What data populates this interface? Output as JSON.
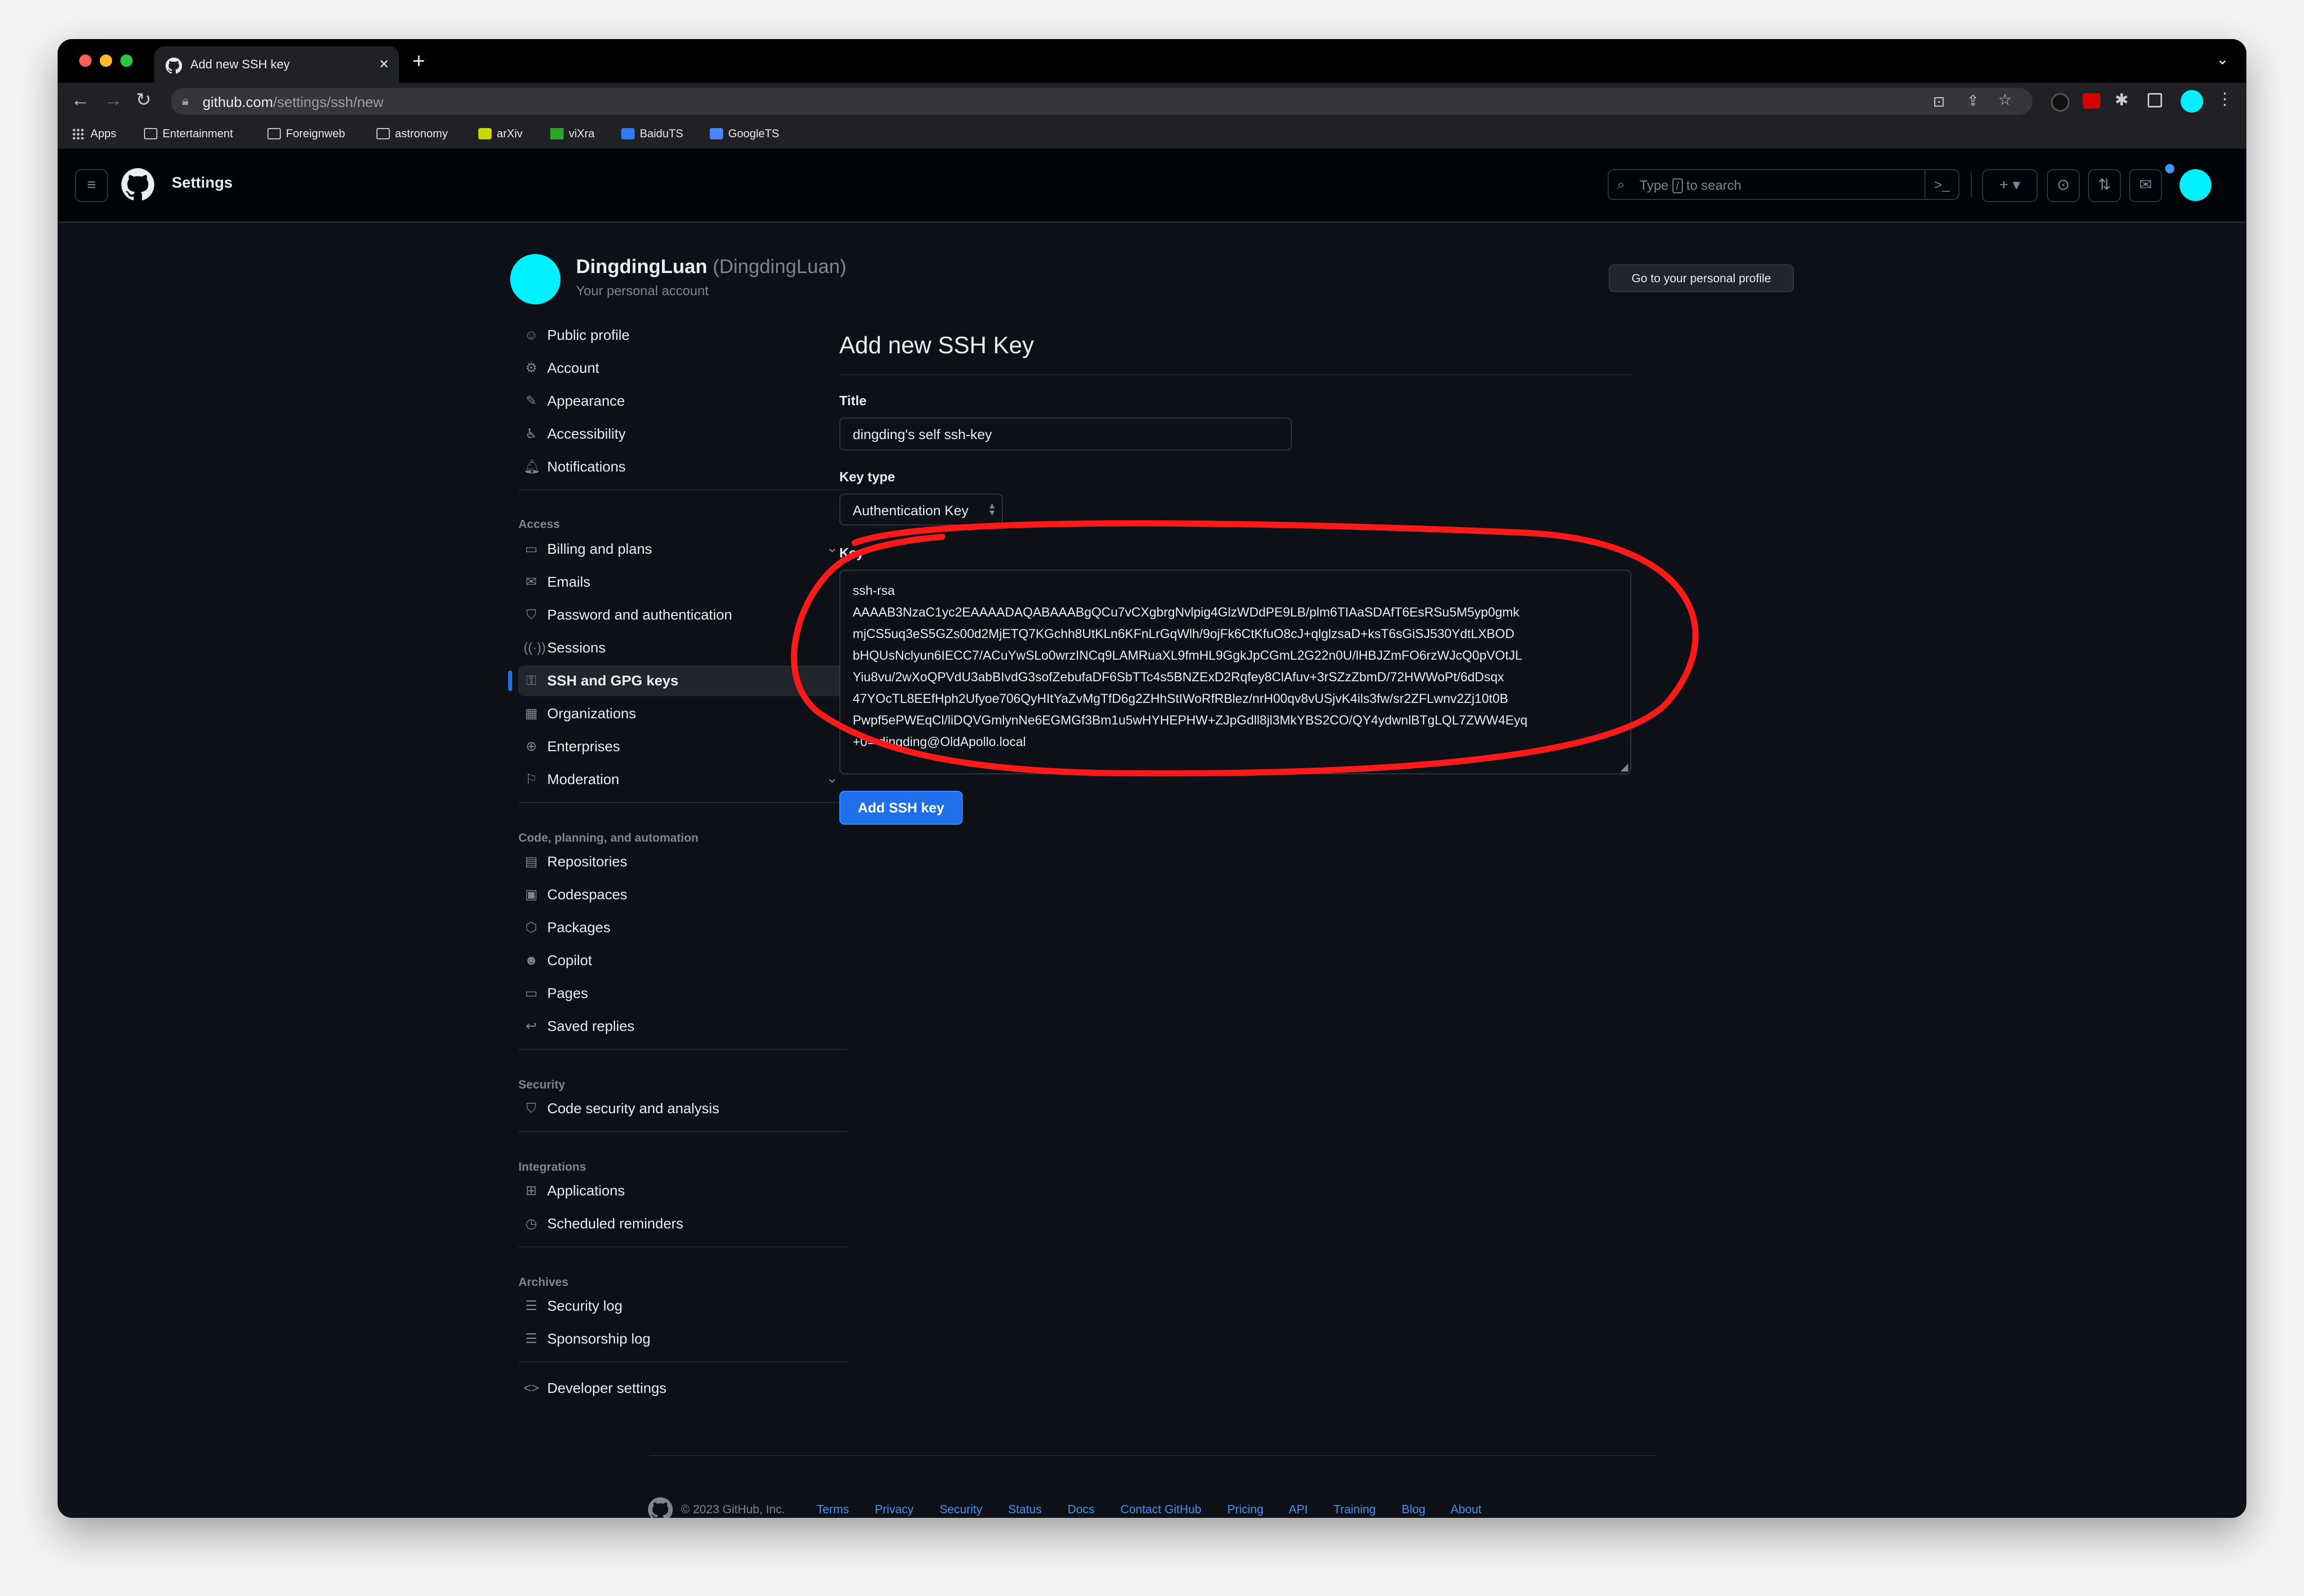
{
  "browser": {
    "tab_title": "Add new SSH key",
    "url_host": "github.com",
    "url_path": "/settings/ssh/new",
    "bookmarks": [
      "Apps",
      "Entertainment",
      "Foreignweb",
      "astronomy",
      "arXiv",
      "viXra",
      "BaiduTS",
      "GoogleTS"
    ]
  },
  "header": {
    "context": "Settings",
    "search_prefix": "Type",
    "search_key": "/",
    "search_suffix": "to search"
  },
  "profile": {
    "name": "DingdingLuan",
    "handle": "(DingdingLuan)",
    "subtitle": "Your personal account",
    "go_profile_label": "Go to your personal profile"
  },
  "sidebar": {
    "items_top": [
      "Public profile",
      "Account",
      "Appearance",
      "Accessibility",
      "Notifications"
    ],
    "group_access": "Access",
    "items_access": [
      "Billing and plans",
      "Emails",
      "Password and authentication",
      "Sessions",
      "SSH and GPG keys",
      "Organizations",
      "Enterprises",
      "Moderation"
    ],
    "group_code": "Code, planning, and automation",
    "items_code": [
      "Repositories",
      "Codespaces",
      "Packages",
      "Copilot",
      "Pages",
      "Saved replies"
    ],
    "group_security": "Security",
    "items_security": [
      "Code security and analysis"
    ],
    "group_integrations": "Integrations",
    "items_integrations": [
      "Applications",
      "Scheduled reminders"
    ],
    "group_archives": "Archives",
    "items_archives": [
      "Security log",
      "Sponsorship log"
    ],
    "developer": "Developer settings"
  },
  "form": {
    "heading": "Add new SSH Key",
    "title_label": "Title",
    "title_value": "dingding's self ssh-key",
    "keytype_label": "Key type",
    "keytype_value": "Authentication Key",
    "key_label": "Key",
    "key_lines": [
      "ssh-rsa",
      "AAAAB3NzaC1yc2EAAAADAQABAAABgQCu7vCXgbrgNvlpig4GlzWDdPE9LB/plm6TIAaSDAfT6EsRSu5M5yp0gmk",
      "mjCS5uq3eS5GZs00d2MjETQ7KGchh8UtKLn6KFnLrGqWlh/9ojFk6CtKfuO8cJ+qlglzsaD+ksT6sGiSJ530YdtLXBOD",
      "bHQUsNclyun6IECC7/ACuYwSLo0wrzINCq9LAMRuaXL9fmHL9GgkJpCGmL2G22n0U/lHBJZmFO6rzWJcQ0pVOtJL",
      "Yiu8vu/2wXoQPVdU3abBIvdG3sofZebufaDF6SbTTc4s5BNZExD2Rqfey8ClAfuv+3rSZzZbmD/72HWWoPt/6dDsqx",
      "47YOcTL8EEfHph2Ufyoe706QyHItYaZvMgTfD6g2ZHhStIWoRfRBlez/nrH00qv8vUSjvK4ils3fw/sr2ZFLwnv2Zj10t0B",
      "Pwpf5ePWEqCl/liDQVGmlynNe6EGMGf3Bm1u5wHYHEPHW+ZJpGdll8jl3MkYBS2CO/QY4ydwnlBTgLQL7ZWW4Eyq",
      "+0= dingding@OldApollo.local"
    ],
    "submit_label": "Add SSH key"
  },
  "footer": {
    "copyright": "© 2023 GitHub, Inc.",
    "links": [
      "Terms",
      "Privacy",
      "Security",
      "Status",
      "Docs",
      "Contact GitHub",
      "Pricing",
      "API",
      "Training",
      "Blog",
      "About"
    ]
  },
  "colors": {
    "accent": "#4493f8",
    "button": "#1f6feb",
    "annotation": "#ff1a1a",
    "avatar": "#00f0ff"
  }
}
